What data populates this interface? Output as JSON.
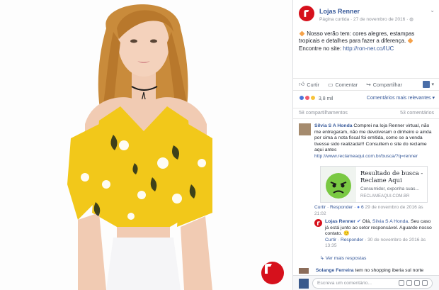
{
  "post": {
    "page_name": "Lojas Renner",
    "meta": "Página curtida · 27 de novembro de 2016 ·",
    "text_line1": "Nosso verão tem: cores alegres, estampas tropicais e detalhes para fazer a diferença.",
    "text_line2_prefix": "Encontre no site: ",
    "link": "http://ron-ner.co/IUC"
  },
  "actions": {
    "like": "Curtir",
    "comment": "Comentar",
    "share": "Compartilhar"
  },
  "reactions": {
    "count": "3,8 mil",
    "relevance": "Comentários mais relevantes ▾"
  },
  "stats": {
    "shares": "58 compartilhamentos",
    "comments": "53 comentários"
  },
  "comment1": {
    "author": "Silvia S A Honda",
    "text": "Comprei na loja Renner virtual, não me entregaram, não me devolveram o dinheiro e ainda por cima a nota fiscal foi emitida, como se a venda tivesse sido realizada!!! Consultem o site do reclame aqui antes",
    "link": "http://www.reclameaqui.com.br/busca/?q=renner",
    "actions": "Curtir · Responder ·",
    "likes": "6",
    "time": "29 de novembro de 2016 às 21:02"
  },
  "preview": {
    "title": "Resultado de busca - Reclame Aqui",
    "subtitle": "Consumidor, exponha suas...",
    "domain": "RECLAMEAQUI.COM.BR"
  },
  "reply1": {
    "author": "Lojas Renner",
    "text_prefix": "Olá, ",
    "mention": "Silvia S A Honda",
    "text": ". Seu caso já está junto ao setor responsável. Aguarde nosso contato. 🙂",
    "actions": "Curtir · Responder ·",
    "time": "30 de novembro de 2016 às 13:35"
  },
  "more_replies": "Ver mais respostas",
  "comment2": {
    "author": "Solange Ferreira",
    "text": "tem no shopping iberia sul norte"
  },
  "input": {
    "placeholder": "Escreva um comentário..."
  },
  "colors": {
    "brand": "#d6111c",
    "link": "#365899",
    "shirt": "#f2c81a"
  }
}
